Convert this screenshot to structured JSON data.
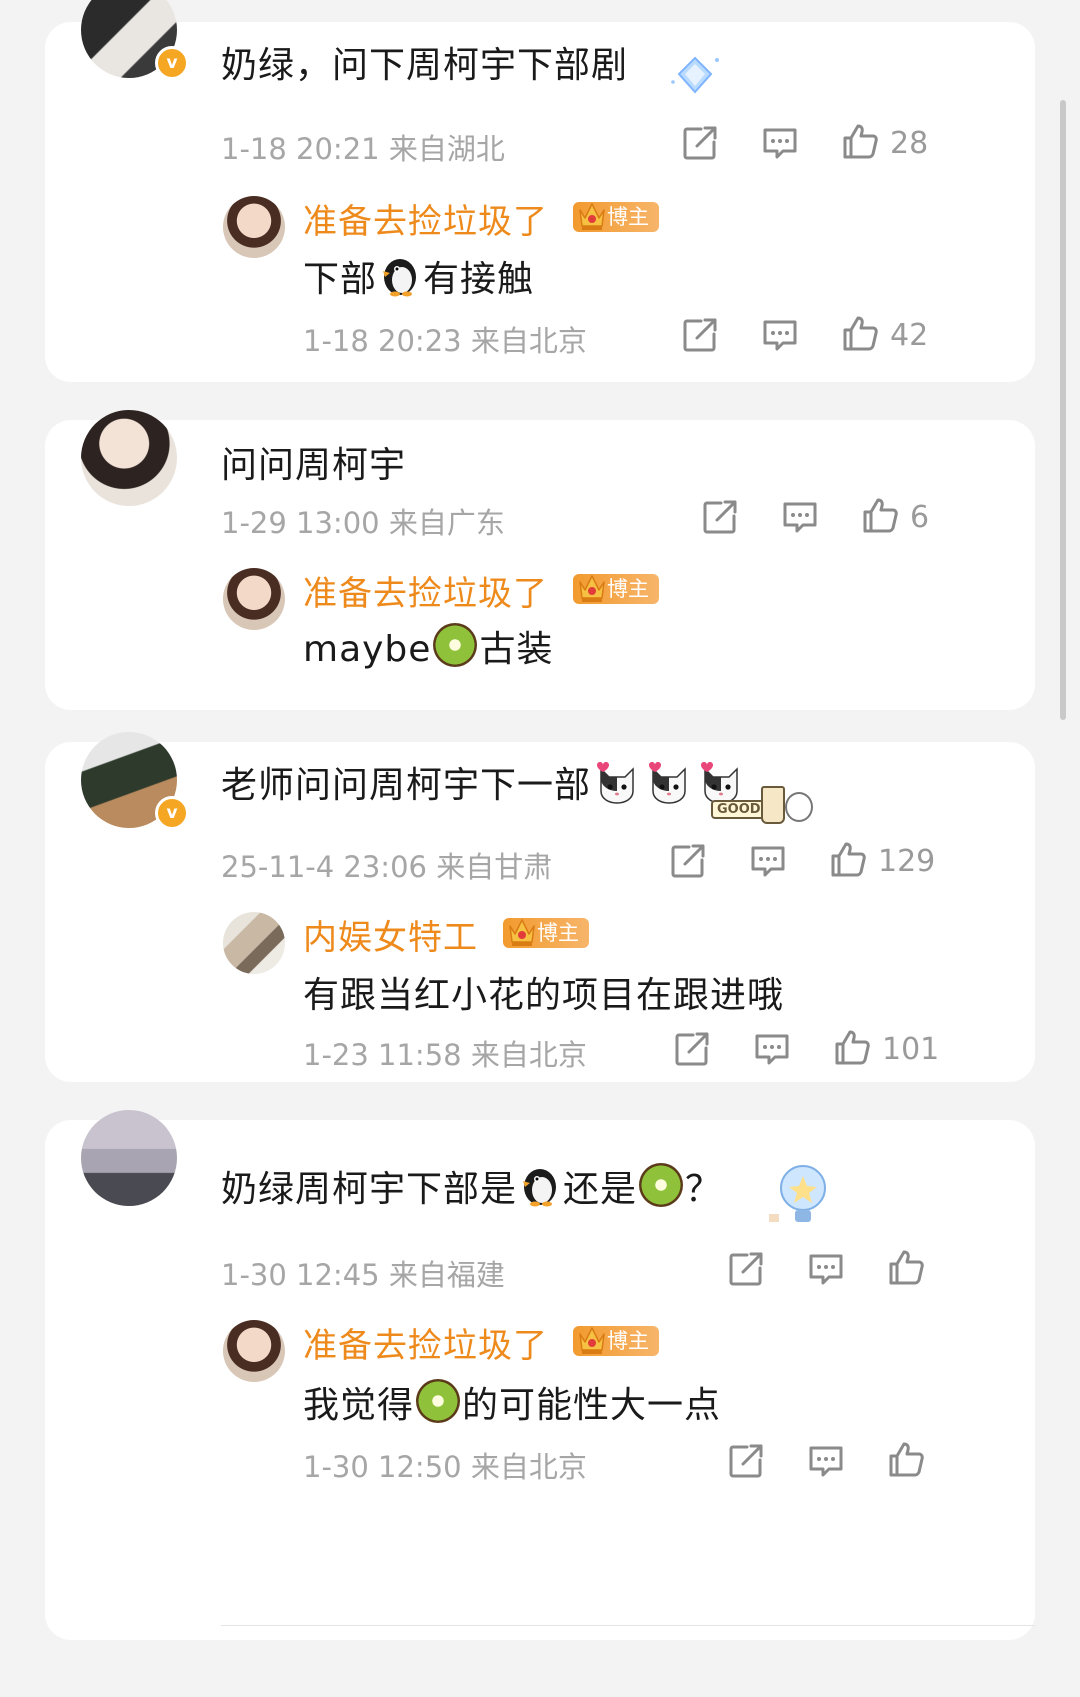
{
  "threads": [
    {
      "comment": {
        "text": "奶绿，问下周柯宇下部剧",
        "meta": "1-18 20:21 来自湖北",
        "likes": "28",
        "verified": true
      },
      "reply": {
        "username": "准备去捡垃圾了",
        "badge": "博主",
        "text_before": "下部",
        "text_after": "有接触",
        "meta": "1-18 20:23 来自北京",
        "likes": "42"
      }
    },
    {
      "comment": {
        "text": "问问周柯宇",
        "meta": "1-29 13:00 来自广东",
        "likes": "6",
        "verified": false
      },
      "reply": {
        "username": "准备去捡垃圾了",
        "badge": "博主",
        "text_before": "maybe",
        "text_after": "古装",
        "meta": "",
        "likes": ""
      }
    },
    {
      "comment": {
        "text": "老师问问周柯宇下一部",
        "meta": "25-11-4 23:06 来自甘肃",
        "likes": "129",
        "verified": true
      },
      "reply": {
        "username": "内娱女特工",
        "badge": "博主",
        "text": "有跟当红小花的项目在跟进哦",
        "meta": "1-23 11:58 来自北京",
        "likes": "101"
      }
    },
    {
      "comment": {
        "text_before": "奶绿周柯宇下部是",
        "text_mid": "还是",
        "text_after": "？",
        "meta": "1-30 12:45 来自福建",
        "likes": "",
        "verified": false
      },
      "reply": {
        "username": "准备去捡垃圾了",
        "badge": "博主",
        "text_before": "我觉得",
        "text_after": "的可能性大一点",
        "meta": "1-30 12:50 来自北京",
        "likes": ""
      }
    }
  ],
  "icons": {
    "share": "share-icon",
    "comment": "comment-icon",
    "like": "thumbs-up-icon",
    "emoji_penguin": "penguin-emoji",
    "emoji_kiwi": "kiwi-emoji",
    "emoji_cat": "cat-emoji"
  },
  "sticker_text": "GOOD",
  "colors": {
    "username": "#ee8a1c",
    "meta": "#a6a6a6",
    "badge": "#f29a2e",
    "verified": "#f5a623"
  }
}
